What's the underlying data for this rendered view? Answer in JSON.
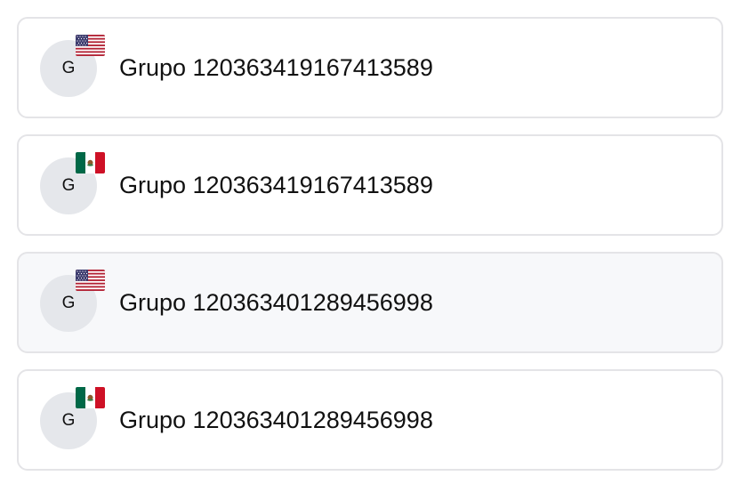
{
  "groups": [
    {
      "name": "Grupo 120363419167413589",
      "avatar_initial": "G",
      "flag_icon": "us-flag-icon"
    },
    {
      "name": "Grupo 120363419167413589",
      "avatar_initial": "G",
      "flag_icon": "mx-flag-icon"
    },
    {
      "name": "Grupo 120363401289456998",
      "avatar_initial": "G",
      "flag_icon": "us-flag-icon",
      "hovered": true
    },
    {
      "name": "Grupo 120363401289456998",
      "avatar_initial": "G",
      "flag_icon": "mx-flag-icon"
    }
  ],
  "colors": {
    "card_border": "#e4e4e7",
    "card_hover_bg": "#f7f8fa",
    "avatar_bg": "#e5e7eb",
    "text": "#111111"
  }
}
